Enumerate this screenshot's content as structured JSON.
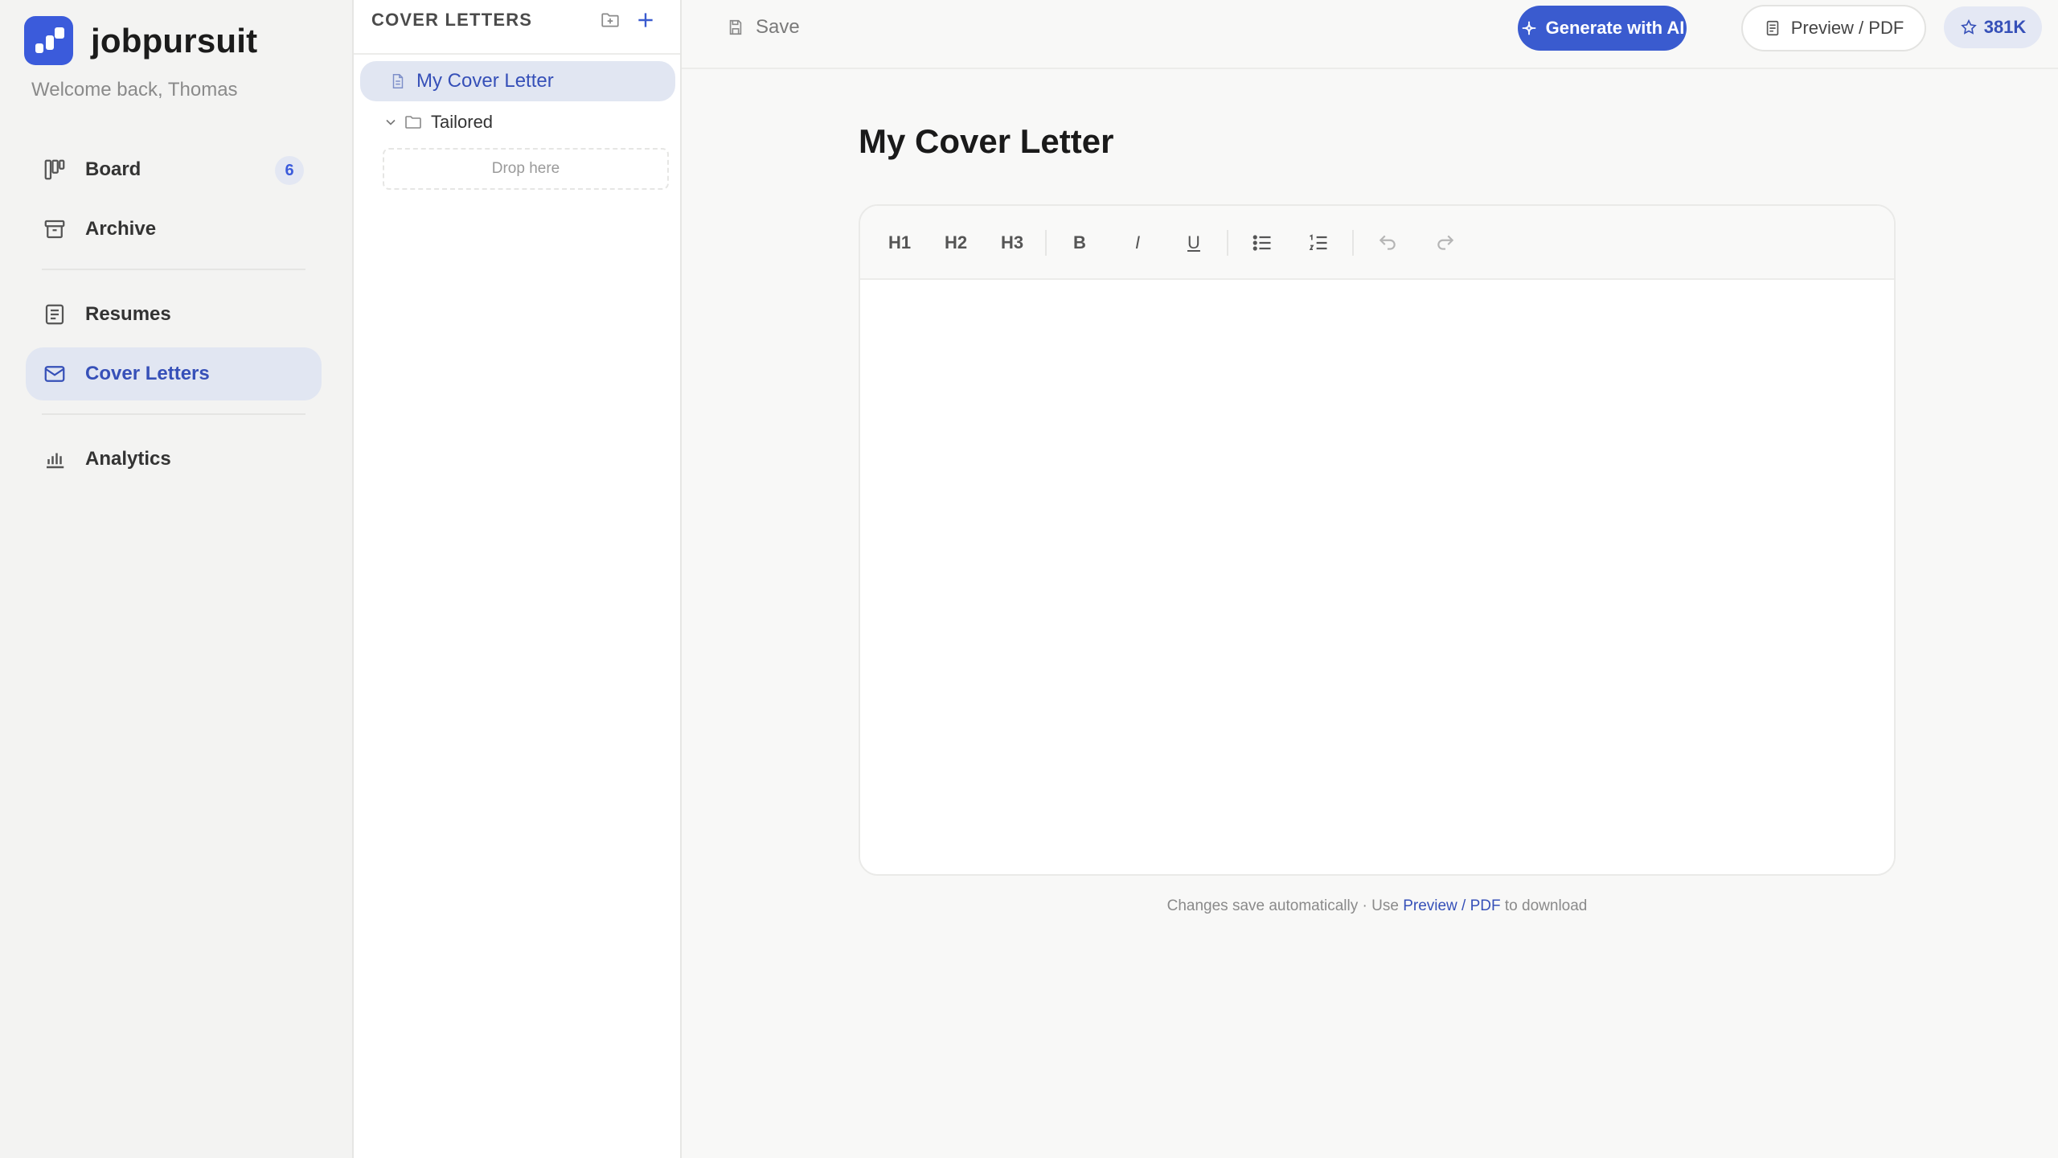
{
  "app": {
    "name": "jobpursuit",
    "welcome": "Welcome back, Thomas"
  },
  "sidebar": {
    "items": [
      {
        "label": "Board",
        "badge": "6",
        "icon": "kanban-icon"
      },
      {
        "label": "Archive",
        "icon": "archive-icon"
      },
      {
        "label": "Resumes",
        "icon": "document-icon"
      },
      {
        "label": "Cover Letters",
        "icon": "mail-icon",
        "active": true
      },
      {
        "label": "Analytics",
        "icon": "bar-chart-icon"
      }
    ]
  },
  "explorer": {
    "title": "COVER LETTERS",
    "files": [
      {
        "label": "My Cover Letter",
        "selected": true
      }
    ],
    "folders": [
      {
        "label": "Tailored",
        "expanded": true,
        "drop_hint": "Drop here"
      }
    ]
  },
  "topbar": {
    "save_label": "Save",
    "generate_label": "Generate with AI",
    "preview_label": "Preview / PDF",
    "stars_label": "381K"
  },
  "document": {
    "title": "My Cover Letter",
    "toolbar": {
      "h1": "H1",
      "h2": "H2",
      "h3": "H3",
      "bold": "B",
      "italic": "I",
      "underline": "U"
    },
    "content": ""
  },
  "footer": {
    "prefix": "Changes save automatically · Use ",
    "link": "Preview / PDF",
    "suffix": " to download"
  },
  "colors": {
    "accent": "#3a5bcf",
    "active_bg": "#e1e6f2",
    "active_text": "#3650b8"
  }
}
